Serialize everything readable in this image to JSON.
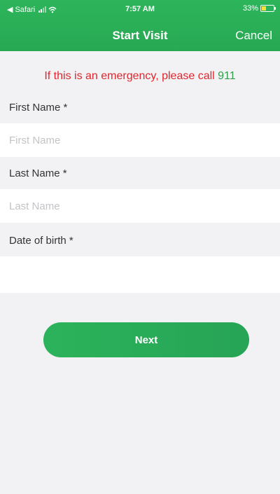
{
  "status_bar": {
    "back_app": "Safari",
    "time": "7:57 AM",
    "battery": "33%"
  },
  "nav": {
    "title": "Start Visit",
    "cancel_label": "Cancel"
  },
  "emergency": {
    "text": "If this is an emergency, please call ",
    "number": "911"
  },
  "form": {
    "first_name": {
      "label": "First Name *",
      "placeholder": "First Name",
      "value": ""
    },
    "last_name": {
      "label": "Last Name *",
      "placeholder": "Last Name",
      "value": ""
    },
    "dob": {
      "label": "Date of birth *"
    }
  },
  "next_label": "Next",
  "colors": {
    "header_green": "#2db55b",
    "button_green": "#2bb35a",
    "emergency_red": "#e0262c",
    "emergency_number_green": "#2e9e48",
    "background": "#f2f2f5"
  }
}
